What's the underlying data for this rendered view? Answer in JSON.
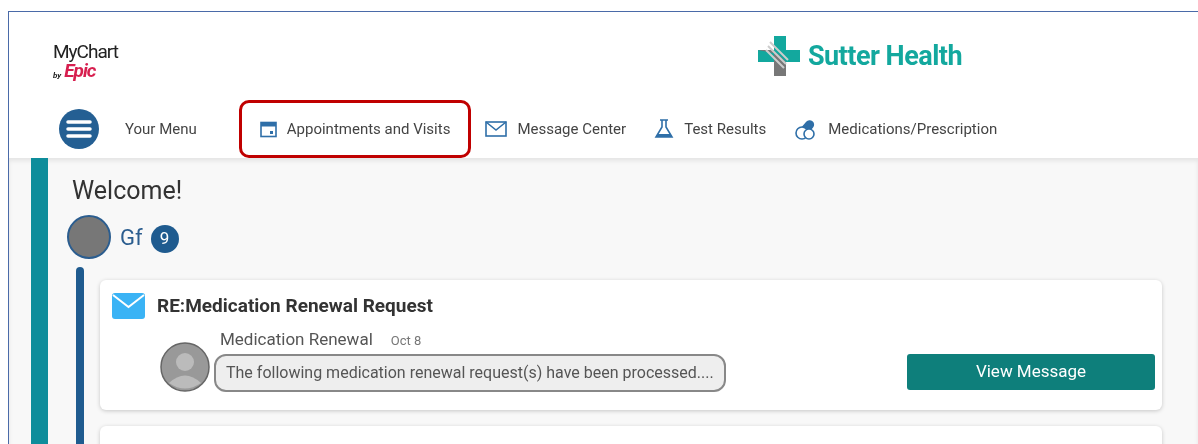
{
  "header": {
    "mychart_logo": "MyChart",
    "epic_by": "by",
    "epic_logo": "Epic",
    "org_name": "Sutter Health"
  },
  "nav": [
    {
      "kind": "menu",
      "label": "Your Menu",
      "highlighted": false
    },
    {
      "kind": "calendar",
      "label": "Appointments and Visits",
      "highlighted": true
    },
    {
      "kind": "mail",
      "label": "Message Center",
      "highlighted": false
    },
    {
      "kind": "flask",
      "label": "Test Results",
      "highlighted": false
    },
    {
      "kind": "pill",
      "label": "Medications/Prescription",
      "highlighted": false
    }
  ],
  "welcome": {
    "title": "Welcome!",
    "user_name": "Gf",
    "badge": "9"
  },
  "messages": [
    {
      "subject": "RE:Medication Renewal Request",
      "sender": "Medication Renewal",
      "date": "Oct 8",
      "preview": "The following medication renewal request(s) have been processed....",
      "button": "View Message"
    }
  ]
}
